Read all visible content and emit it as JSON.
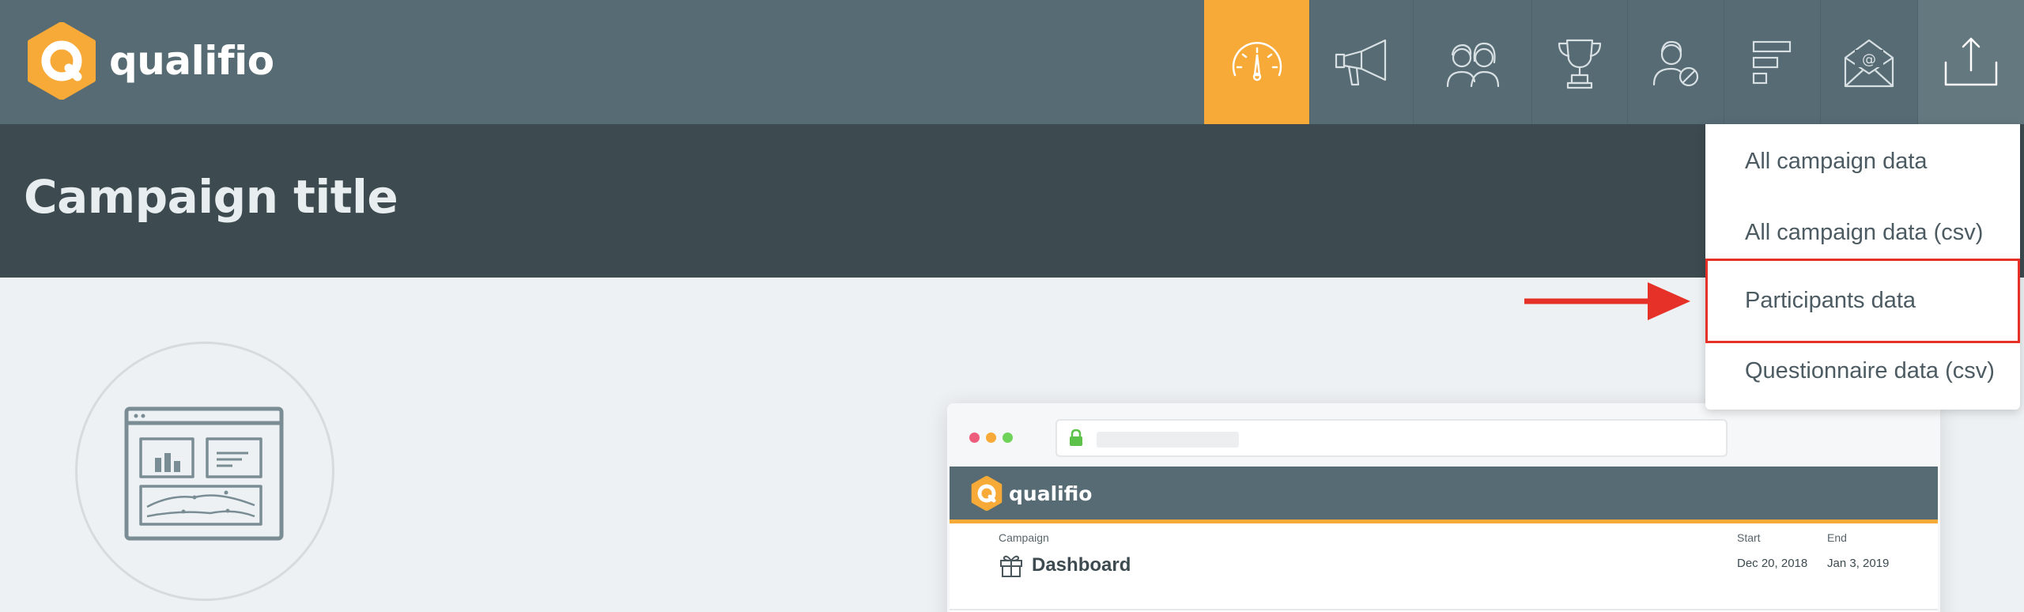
{
  "header": {
    "brand": "qualifio",
    "nav": [
      {
        "icon": "dashboard-gauge-icon",
        "active": true
      },
      {
        "icon": "megaphone-icon"
      },
      {
        "icon": "users-icon"
      },
      {
        "icon": "trophy-icon"
      },
      {
        "icon": "user-blocked-icon"
      },
      {
        "icon": "steps-icon"
      },
      {
        "icon": "email-envelope-icon"
      },
      {
        "icon": "export-upload-icon"
      }
    ],
    "colors": {
      "bar": "#566b74",
      "active": "#f7aa38"
    }
  },
  "title_band": {
    "title": "Campaign title"
  },
  "export_menu": {
    "items": [
      {
        "label": "All campaign data"
      },
      {
        "label": "All campaign data (csv)"
      },
      {
        "label": "Participants data",
        "highlighted": true
      },
      {
        "label": "Questionnaire data (csv)"
      }
    ],
    "highlight_color": "#e53127"
  },
  "mockup": {
    "brand": "qualifio",
    "campaign_label": "Campaign",
    "dashboard_title": "Dashboard",
    "start_label": "Start",
    "start_date": "Dec 20, 2018",
    "end_label": "End",
    "end_date": "Jan 3, 2019",
    "window_dot_colors": [
      "#ef5d7d",
      "#f7aa38",
      "#6fd35a"
    ]
  }
}
